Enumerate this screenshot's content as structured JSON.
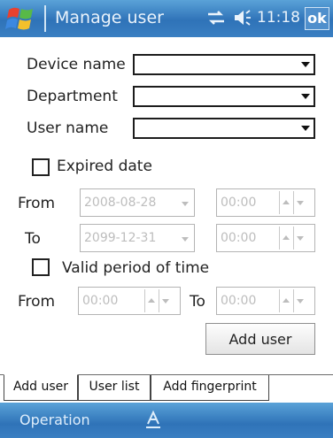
{
  "window": {
    "title": "Manage user",
    "clock": "11:18",
    "ok_label": "ok"
  },
  "form": {
    "device_name_label": "Device name",
    "department_label": "Department",
    "user_name_label": "User name",
    "expired_date_label": "Expired date",
    "expired_date_checked": false,
    "expired_from_label": "From",
    "expired_from_date": "2008-08-28",
    "expired_from_time": "00:00",
    "expired_to_label": "To",
    "expired_to_date": "2099-12-31",
    "expired_to_time": "00:00",
    "valid_period_label": "Valid period of time",
    "valid_period_checked": false,
    "period_from_label": "From",
    "period_from_time": "00:00",
    "period_to_label": "To",
    "period_to_time": "00:00",
    "add_user_button": "Add user"
  },
  "tabs": [
    {
      "label": "Add user",
      "active": true
    },
    {
      "label": "User list",
      "active": false
    },
    {
      "label": "Add fingerprint",
      "active": false
    }
  ],
  "menubar": {
    "operation_label": "Operation"
  },
  "icons": {
    "start": "windows-start-icon",
    "connectivity": "connectivity-icon",
    "volume": "speaker-icon",
    "keyboard": "keyboard-input-icon"
  },
  "colors": {
    "titlebar": "#2f73b8",
    "disabled_text": "#bdbdbd"
  }
}
